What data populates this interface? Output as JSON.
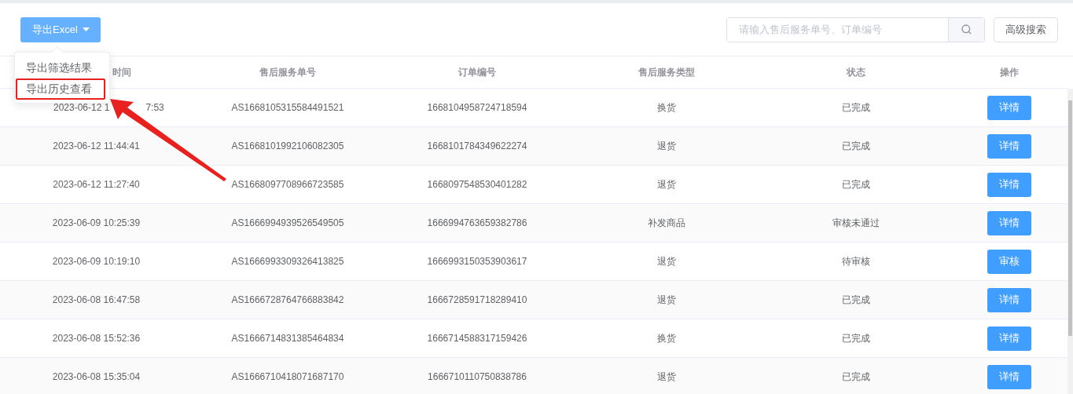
{
  "toolbar": {
    "export_button": {
      "label": "导出Excel",
      "menu_open": true
    },
    "search": {
      "placeholder": "请输入售后服务单号、订单编号"
    },
    "advanced_search": "高级搜索"
  },
  "export_menu": [
    {
      "label": "导出筛选结果",
      "annotated": false
    },
    {
      "label": "导出历史查看",
      "annotated": true
    }
  ],
  "table": {
    "columns": [
      "时间",
      "售后服务单号",
      "订单编号",
      "售后服务类型",
      "状态",
      "操作"
    ],
    "rows": [
      {
        "time_parts": [
          "2023-06-12 1",
          "7:53"
        ],
        "service_no": "AS1668105315584491521",
        "order_no": "1668104958724718594",
        "type": "换货",
        "status": "已完成",
        "action": "详情"
      },
      {
        "time_parts": [
          "2023-06-12 11:44:41"
        ],
        "service_no": "AS1668101992106082305",
        "order_no": "1668101784349622274",
        "type": "退货",
        "status": "已完成",
        "action": "详情"
      },
      {
        "time_parts": [
          "2023-06-12 11:27:40"
        ],
        "service_no": "AS1668097708966723585",
        "order_no": "1668097548530401282",
        "type": "退货",
        "status": "已完成",
        "action": "详情"
      },
      {
        "time_parts": [
          "2023-06-09 10:25:39"
        ],
        "service_no": "AS1666994939526549505",
        "order_no": "1666994763659382786",
        "type": "补发商品",
        "status": "审核未通过",
        "action": "详情"
      },
      {
        "time_parts": [
          "2023-06-09 10:19:10"
        ],
        "service_no": "AS1666993309326413825",
        "order_no": "1666993150353903617",
        "type": "退货",
        "status": "待审核",
        "action": "审核"
      },
      {
        "time_parts": [
          "2023-06-08 16:47:58"
        ],
        "service_no": "AS1666728764766883842",
        "order_no": "1666728591718289410",
        "type": "退货",
        "status": "已完成",
        "action": "详情"
      },
      {
        "time_parts": [
          "2023-06-08 15:52:36"
        ],
        "service_no": "AS1666714831385464834",
        "order_no": "1666714588317159426",
        "type": "换货",
        "status": "已完成",
        "action": "详情"
      },
      {
        "time_parts": [
          "2023-06-08 15:35:04"
        ],
        "service_no": "AS1666710418071687170",
        "order_no": "1666710110750838786",
        "type": "退货",
        "status": "已完成",
        "action": "详情"
      }
    ]
  }
}
